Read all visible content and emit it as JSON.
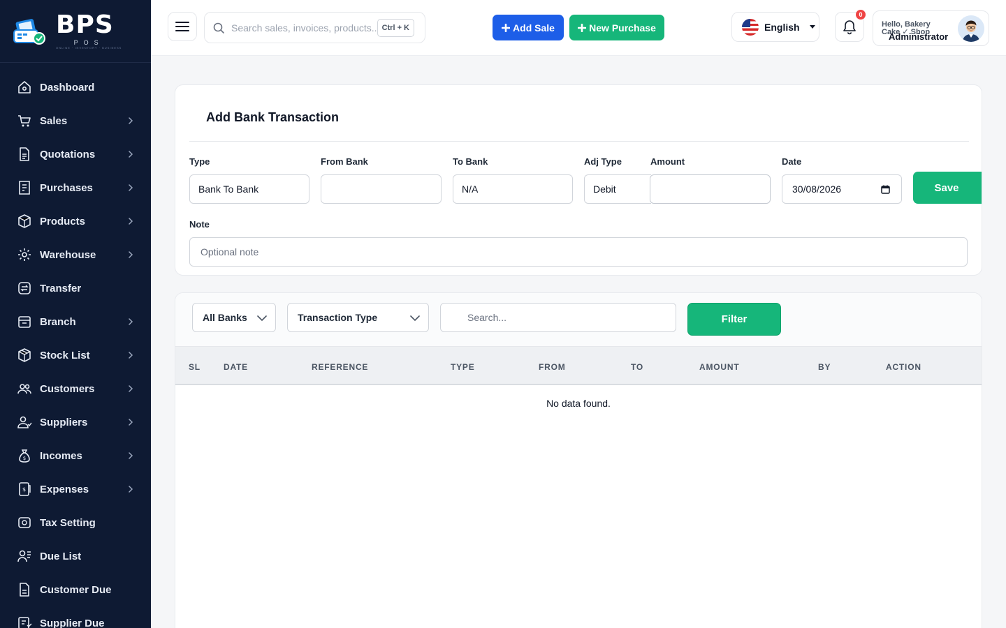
{
  "brand": {
    "name": "BPS",
    "sub": "POS",
    "tag": "ONLINE · INVENTORY · BUSINESS"
  },
  "sidebar": {
    "items": [
      {
        "label": "Dashboard",
        "icon": "home-icon",
        "has_children": false
      },
      {
        "label": "Sales",
        "icon": "cart-icon",
        "has_children": true
      },
      {
        "label": "Quotations",
        "icon": "document-icon",
        "has_children": true
      },
      {
        "label": "Purchases",
        "icon": "receipt-icon",
        "has_children": true
      },
      {
        "label": "Products",
        "icon": "box-icon",
        "has_children": true
      },
      {
        "label": "Warehouse",
        "icon": "warehouse-icon",
        "has_children": true
      },
      {
        "label": "Transfer",
        "icon": "transfer-icon",
        "has_children": false
      },
      {
        "label": "Branch",
        "icon": "branch-icon",
        "has_children": true
      },
      {
        "label": "Stock List",
        "icon": "stock-icon",
        "has_children": true
      },
      {
        "label": "Customers",
        "icon": "customers-icon",
        "has_children": true
      },
      {
        "label": "Suppliers",
        "icon": "suppliers-icon",
        "has_children": true
      },
      {
        "label": "Incomes",
        "icon": "money-bag-icon",
        "has_children": true
      },
      {
        "label": "Expenses",
        "icon": "expense-icon",
        "has_children": true
      },
      {
        "label": "Tax Setting",
        "icon": "tax-icon",
        "has_children": false
      },
      {
        "label": "Due List",
        "icon": "due-list-icon",
        "has_children": false
      },
      {
        "label": "Customer Due",
        "icon": "customer-due-icon",
        "has_children": false
      },
      {
        "label": "Supplier Due",
        "icon": "supplier-due-icon",
        "has_children": false
      }
    ]
  },
  "header": {
    "search_placeholder": "Search sales, invoices, products...",
    "shortcut": "Ctrl + K",
    "add_sale": "Add Sale",
    "new_purchase": "New Purchase",
    "language": "English",
    "notifications": "0",
    "greeting": "Hello, Bakery Cake ✓ Shop",
    "role": "Administrator"
  },
  "form": {
    "title": "Add Bank Transaction",
    "type_label": "Type",
    "type_value": "Bank To Bank",
    "from_bank_label": "From Bank",
    "from_bank_value": "",
    "to_bank_label": "To Bank",
    "to_bank_value": "N/A",
    "adj_type_label": "Adj Type",
    "adj_type_value": "Debit",
    "amount_label": "Amount",
    "amount_value": "",
    "date_label": "Date",
    "date_value": "30/08/2026",
    "save": "Save",
    "note_label": "Note",
    "note_placeholder": "Optional note"
  },
  "filters": {
    "banks": "All Banks",
    "transaction_type": "Transaction Type",
    "search_placeholder": "Search...",
    "filter": "Filter"
  },
  "table": {
    "columns": [
      "SL",
      "DATE",
      "REFERENCE",
      "TYPE",
      "FROM",
      "TO",
      "AMOUNT",
      "BY",
      "ACTION"
    ],
    "empty": "No data found."
  },
  "colors": {
    "sidebar_bg": "#0e1a33",
    "primary_blue": "#1d5ee8",
    "primary_green": "#16b67a",
    "badge_red": "#ef4444"
  }
}
